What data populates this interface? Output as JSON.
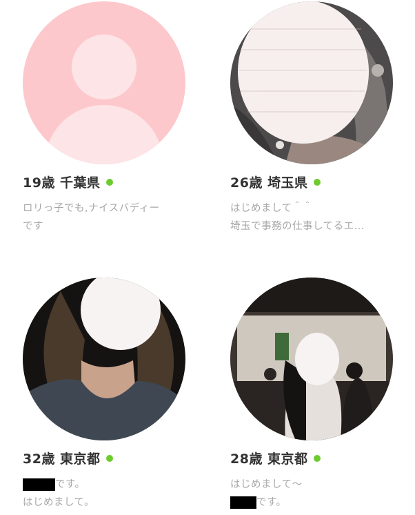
{
  "colors": {
    "placeholder_bg": "#fdc8cc",
    "placeholder_fg": "#fde4e6",
    "online": "#6ccc2e",
    "text_primary": "#333333",
    "text_secondary": "#a7a7a7",
    "redaction": "#000000"
  },
  "profiles": [
    {
      "age": "19歳",
      "prefecture": "千葉県",
      "online": true,
      "avatar_icon": "default-user-avatar-icon",
      "message": {
        "line1": "ロリっ子でも,ナイスバディー",
        "line2": "です"
      }
    },
    {
      "age": "26歳",
      "prefecture": "埼玉県",
      "online": true,
      "avatar_icon": "profile-photo-face-blurred",
      "message": {
        "line1": "はじめまして＾＾",
        "line2": "埼玉で事務の仕事してるエ..."
      }
    },
    {
      "age": "32歳",
      "prefecture": "東京都",
      "online": true,
      "avatar_icon": "profile-photo-face-blurred",
      "message": {
        "line1_suffix": "です。",
        "line2": "はじめまして。"
      }
    },
    {
      "age": "28歳",
      "prefecture": "東京都",
      "online": true,
      "avatar_icon": "profile-photo-face-blurred",
      "message": {
        "line1": "はじめまして〜",
        "line2_suffix": "です。"
      }
    }
  ]
}
